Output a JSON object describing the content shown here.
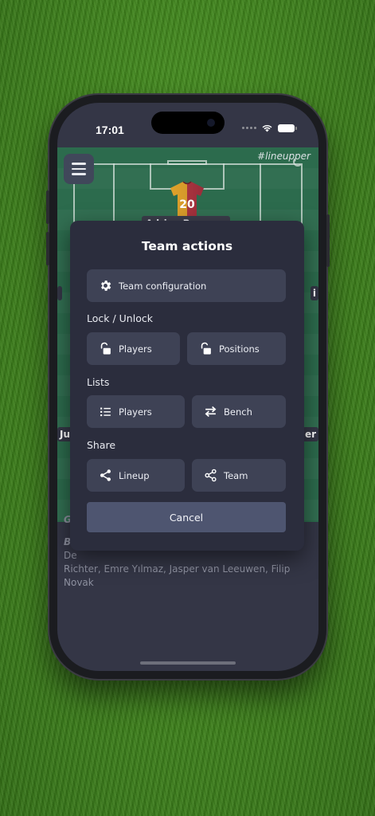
{
  "status_bar": {
    "time": "17:01"
  },
  "pitch": {
    "hashtag": "#lineupper",
    "jersey_number": "20",
    "player_name": "Adrian Popescu",
    "left_edge_label": "Ju",
    "right_edge_label_mid": "i",
    "right_edge_label_low": "er"
  },
  "below": {
    "g_label": "G",
    "bench_label": "B",
    "bench_line1": "De",
    "bench_line2": "Richter, Emre Yılmaz, Jasper van Leeuwen, Filip",
    "bench_line3": "Novak"
  },
  "modal": {
    "title": "Team actions",
    "team_config_label": "Team configuration",
    "lock_section": "Lock / Unlock",
    "lock_players_label": "Players",
    "lock_positions_label": "Positions",
    "lists_section": "Lists",
    "list_players_label": "Players",
    "list_bench_label": "Bench",
    "share_section": "Share",
    "share_lineup_label": "Lineup",
    "share_team_label": "Team",
    "cancel_label": "Cancel"
  },
  "colors": {
    "grass": "#3d8319",
    "pitch": "#2c6b4d",
    "modal_bg": "#2b2d3d",
    "button_bg": "#3e4255",
    "cancel_bg": "#4e5570"
  },
  "icons": [
    "gear-icon",
    "unlock-icon",
    "list-icon",
    "swap-icon",
    "share-icon",
    "share-nodes-icon",
    "menu-icon",
    "wifi-icon",
    "battery-icon"
  ]
}
